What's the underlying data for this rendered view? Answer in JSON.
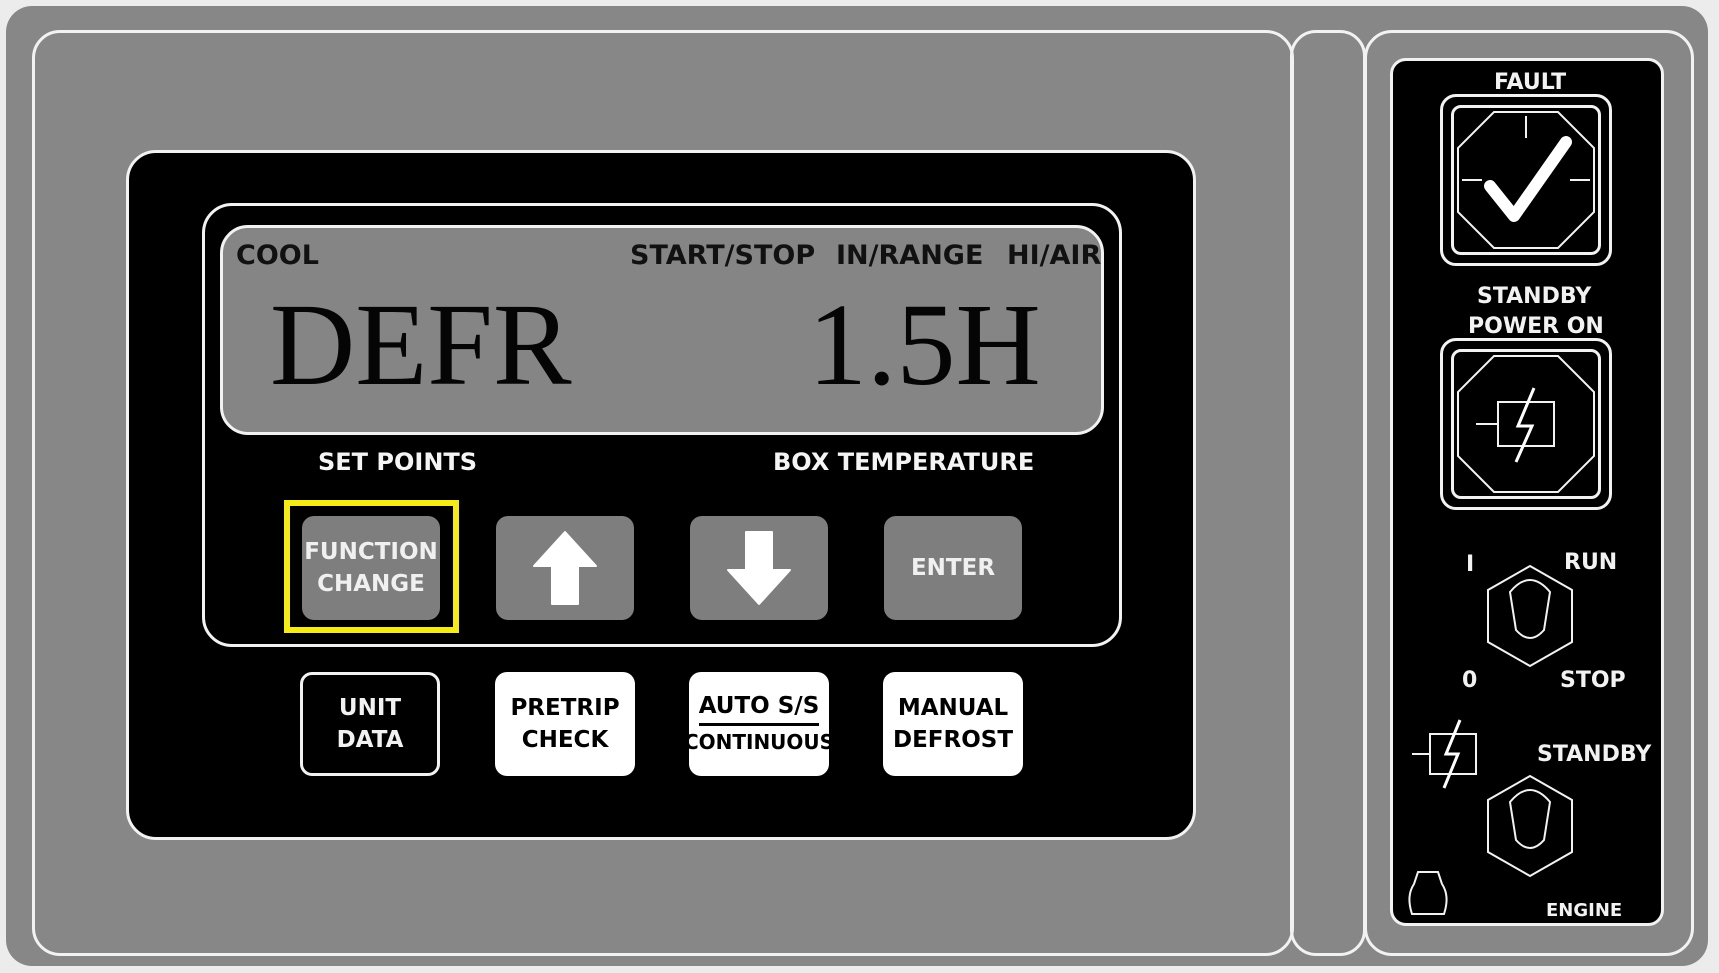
{
  "display": {
    "indicators": {
      "cool": "COOL",
      "start_stop": "START/STOP",
      "in_range": "IN/RANGE",
      "hi_air": "HI/AIR"
    },
    "left_readout": "DEFR",
    "right_readout": "1.5H"
  },
  "captions": {
    "set_points": "SET POINTS",
    "box_temperature": "BOX TEMPERATURE"
  },
  "keys": {
    "function_change": [
      "FUNCTION",
      "CHANGE"
    ],
    "up_icon": "up-arrow-icon",
    "down_icon": "down-arrow-icon",
    "enter": "ENTER"
  },
  "bottom_keys": {
    "unit_data": [
      "UNIT",
      "DATA"
    ],
    "pretrip_check": [
      "PRETRIP",
      "CHECK"
    ],
    "auto_ss": "AUTO S/S",
    "continuous": "CONTINUOUS",
    "manual_defrost": [
      "MANUAL",
      "DEFROST"
    ]
  },
  "side": {
    "fault": "FAULT",
    "standby_power_on": [
      "STANDBY",
      "POWER ON"
    ],
    "run": "RUN",
    "i": "I",
    "o": "0",
    "stop": "STOP",
    "standby": "STANDBY",
    "engine": "ENGINE"
  },
  "colors": {
    "highlight": "#f5ec17",
    "panel": "#878787",
    "lcd": "#858585"
  }
}
